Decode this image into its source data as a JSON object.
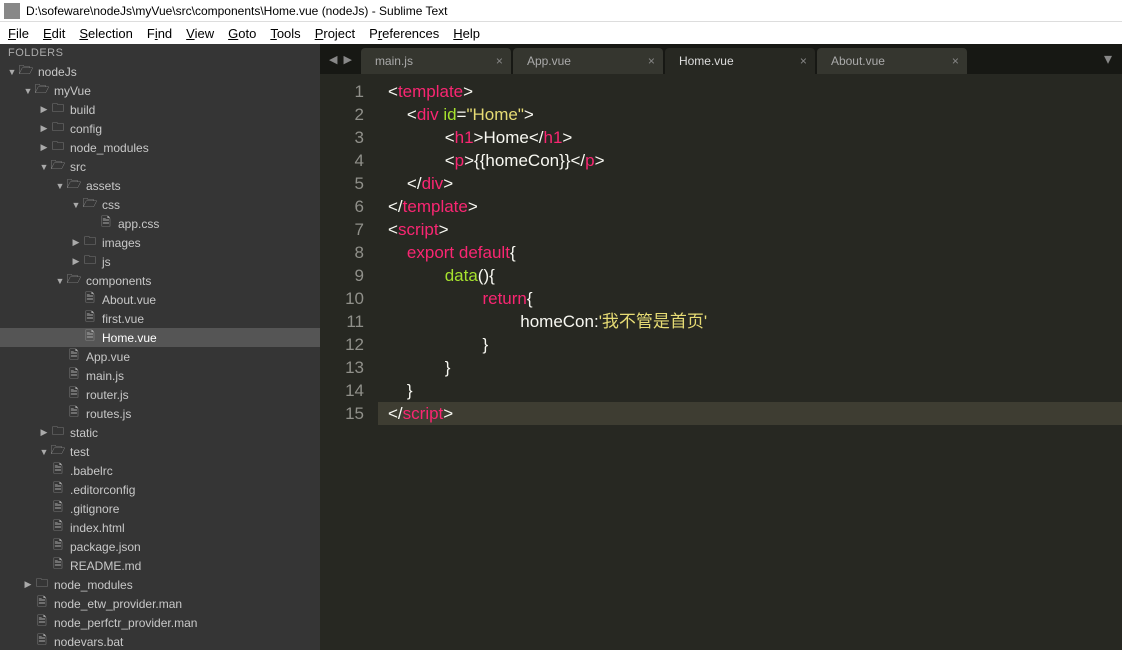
{
  "window": {
    "title": "D:\\sofeware\\nodeJs\\myVue\\src\\components\\Home.vue (nodeJs) - Sublime Text"
  },
  "menu": {
    "file": "File",
    "edit": "Edit",
    "selection": "Selection",
    "find": "Find",
    "view": "View",
    "goto": "Goto",
    "tools": "Tools",
    "project": "Project",
    "preferences": "Preferences",
    "help": "Help"
  },
  "sidebar": {
    "header": "FOLDERS",
    "tree": [
      {
        "depth": 0,
        "type": "folder-open",
        "label": "nodeJs",
        "expanded": true
      },
      {
        "depth": 1,
        "type": "folder-open",
        "label": "myVue",
        "expanded": true
      },
      {
        "depth": 2,
        "type": "folder",
        "label": "build",
        "expanded": false,
        "hasArrow": true
      },
      {
        "depth": 2,
        "type": "folder",
        "label": "config",
        "expanded": false,
        "hasArrow": true
      },
      {
        "depth": 2,
        "type": "folder",
        "label": "node_modules",
        "expanded": false,
        "hasArrow": true
      },
      {
        "depth": 2,
        "type": "folder-open",
        "label": "src",
        "expanded": true
      },
      {
        "depth": 3,
        "type": "folder-open",
        "label": "assets",
        "expanded": true
      },
      {
        "depth": 4,
        "type": "folder-open",
        "label": "css",
        "expanded": true
      },
      {
        "depth": 5,
        "type": "file",
        "label": "app.css"
      },
      {
        "depth": 4,
        "type": "folder",
        "label": "images",
        "expanded": false,
        "hasArrow": true
      },
      {
        "depth": 4,
        "type": "folder",
        "label": "js",
        "expanded": false,
        "hasArrow": true
      },
      {
        "depth": 3,
        "type": "folder-open",
        "label": "components",
        "expanded": true
      },
      {
        "depth": 4,
        "type": "file",
        "label": "About.vue"
      },
      {
        "depth": 4,
        "type": "file",
        "label": "first.vue"
      },
      {
        "depth": 4,
        "type": "file",
        "label": "Home.vue",
        "selected": true
      },
      {
        "depth": 3,
        "type": "file",
        "label": "App.vue"
      },
      {
        "depth": 3,
        "type": "file",
        "label": "main.js"
      },
      {
        "depth": 3,
        "type": "file",
        "label": "router.js"
      },
      {
        "depth": 3,
        "type": "file",
        "label": "routes.js"
      },
      {
        "depth": 2,
        "type": "folder",
        "label": "static",
        "expanded": false,
        "hasArrow": true
      },
      {
        "depth": 2,
        "type": "folder-open",
        "label": "test",
        "expanded": true
      },
      {
        "depth": 2,
        "type": "file",
        "label": ".babelrc"
      },
      {
        "depth": 2,
        "type": "file",
        "label": ".editorconfig"
      },
      {
        "depth": 2,
        "type": "file",
        "label": ".gitignore"
      },
      {
        "depth": 2,
        "type": "file",
        "label": "index.html"
      },
      {
        "depth": 2,
        "type": "file",
        "label": "package.json"
      },
      {
        "depth": 2,
        "type": "file",
        "label": "README.md"
      },
      {
        "depth": 1,
        "type": "folder",
        "label": "node_modules",
        "expanded": false,
        "hasArrow": true
      },
      {
        "depth": 1,
        "type": "file",
        "label": "node_etw_provider.man"
      },
      {
        "depth": 1,
        "type": "file",
        "label": "node_perfctr_provider.man"
      },
      {
        "depth": 1,
        "type": "file",
        "label": "nodevars.bat"
      }
    ]
  },
  "tabs": {
    "nav_prev": "◀",
    "nav_next": "▶",
    "plus": "▾",
    "items": [
      {
        "label": "main.js",
        "active": false
      },
      {
        "label": "App.vue",
        "active": false
      },
      {
        "label": "Home.vue",
        "active": true
      },
      {
        "label": "About.vue",
        "active": false
      }
    ],
    "close": "×"
  },
  "code": {
    "lines": [
      {
        "n": "1",
        "html": "<span class='brk'>&lt;</span><span class='pnk'>template</span><span class='brk'>&gt;</span>"
      },
      {
        "n": "2",
        "html": "    <span class='brk'>&lt;</span><span class='pnk'>div</span> <span class='grn'>id</span><span class='wht'>=</span><span class='yel'>\"Home\"</span><span class='brk'>&gt;</span>"
      },
      {
        "n": "3",
        "html": "            <span class='brk'>&lt;</span><span class='pnk'>h1</span><span class='brk'>&gt;</span><span class='wht'>Home</span><span class='brk'>&lt;/</span><span class='pnk'>h1</span><span class='brk'>&gt;</span>"
      },
      {
        "n": "4",
        "html": "            <span class='brk'>&lt;</span><span class='pnk'>p</span><span class='brk'>&gt;</span><span class='wht'>{{homeCon}}</span><span class='brk'>&lt;/</span><span class='pnk'>p</span><span class='brk'>&gt;</span>"
      },
      {
        "n": "5",
        "html": "    <span class='brk'>&lt;/</span><span class='pnk'>div</span><span class='brk'>&gt;</span>"
      },
      {
        "n": "6",
        "html": "<span class='brk'>&lt;/</span><span class='pnk'>template</span><span class='brk'>&gt;</span>"
      },
      {
        "n": "7",
        "html": "<span class='brk'>&lt;</span><span class='pnk'>script</span><span class='brk'>&gt;</span>"
      },
      {
        "n": "8",
        "html": "    <span class='pnk'>export</span> <span class='pnk'>default</span><span class='wht'>{</span>"
      },
      {
        "n": "9",
        "html": "            <span class='grn'>data</span><span class='wht'>(){</span>"
      },
      {
        "n": "10",
        "html": "                    <span class='pnk'>return</span><span class='wht'>{</span>"
      },
      {
        "n": "11",
        "html": "                            <span class='wht'>homeCon:</span><span class='yel'>'我不管是首页'</span>"
      },
      {
        "n": "12",
        "html": "                    <span class='wht'>}</span>"
      },
      {
        "n": "13",
        "html": "            <span class='wht'>}</span>"
      },
      {
        "n": "14",
        "html": "    <span class='wht'>}</span>"
      },
      {
        "n": "15",
        "html": "<span class='brk'>&lt;/</span><span class='pnk'>script</span><span class='brk'>&gt;</span>",
        "hl": true
      }
    ]
  }
}
